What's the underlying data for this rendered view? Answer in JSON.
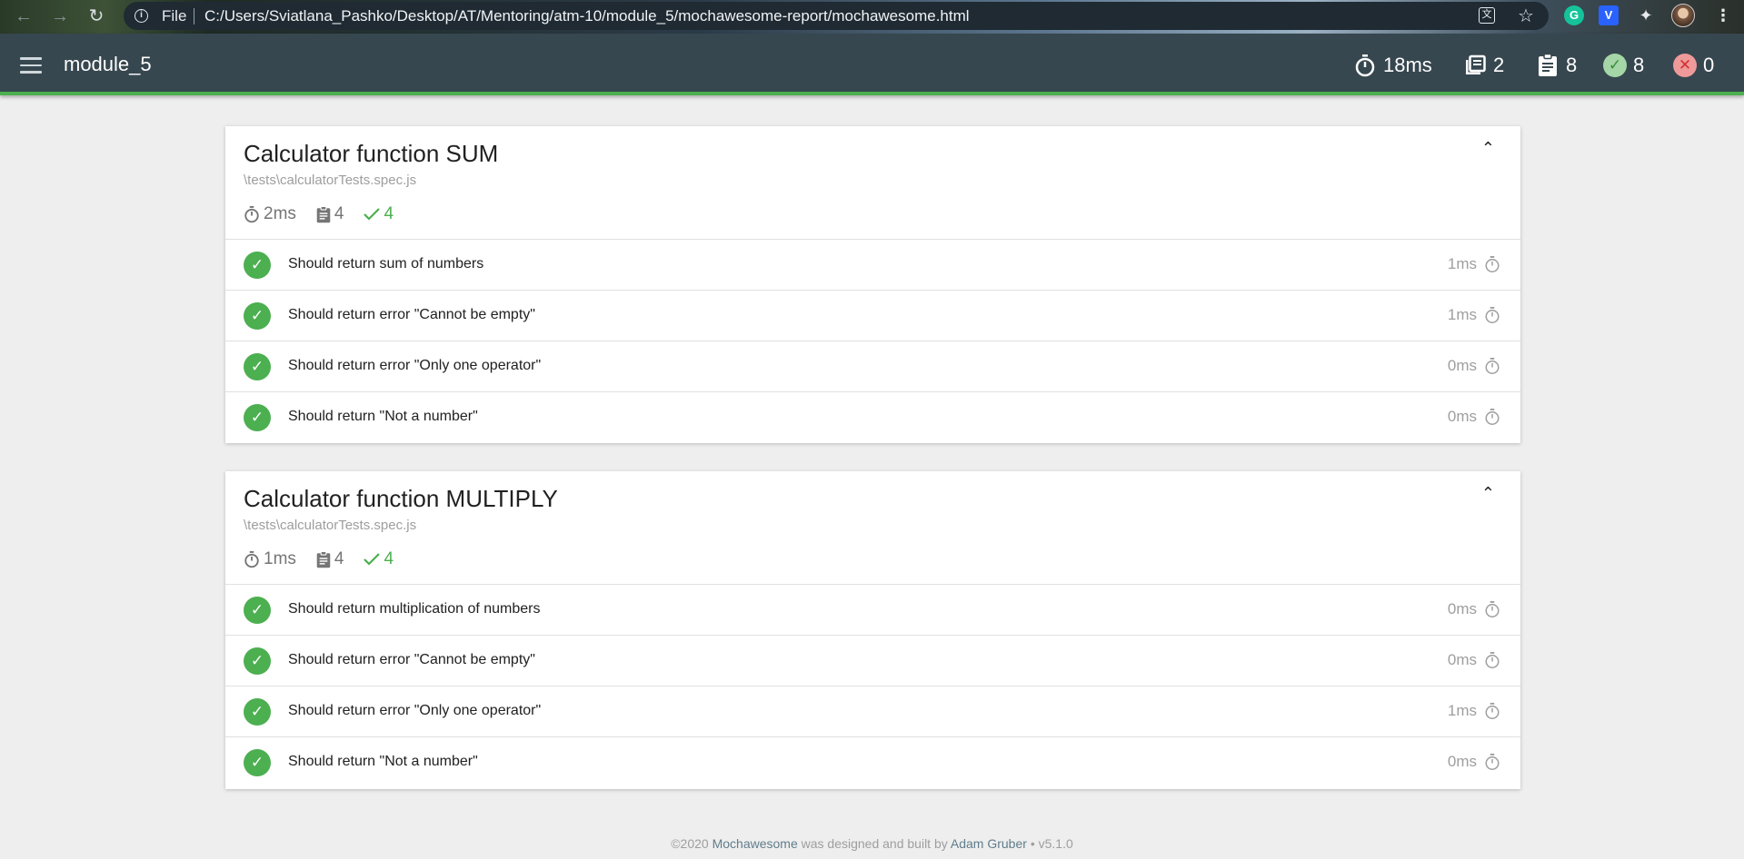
{
  "browser": {
    "protocol_label": "File",
    "url": "C:/Users/Sviatlana_Pashko/Desktop/AT/Mentoring/atm-10/module_5/mochawesome-report/mochawesome.html",
    "extensions": {
      "grammarly": "G",
      "v_ext": "V"
    }
  },
  "navbar": {
    "title": "module_5",
    "duration": "18ms",
    "suites": "2",
    "tests": "8",
    "passes": "8",
    "failures": "0"
  },
  "suites": [
    {
      "title": "Calculator function SUM",
      "file": "\\tests\\calculatorTests.spec.js",
      "duration": "2ms",
      "tests": "4",
      "passes": "4",
      "items": [
        {
          "title": "Should return sum of numbers",
          "duration": "1ms"
        },
        {
          "title": "Should return error \"Cannot be empty\"",
          "duration": "1ms"
        },
        {
          "title": "Should return error \"Only one operator\"",
          "duration": "0ms"
        },
        {
          "title": "Should return \"Not a number\"",
          "duration": "0ms"
        }
      ]
    },
    {
      "title": "Calculator function MULTIPLY",
      "file": "\\tests\\calculatorTests.spec.js",
      "duration": "1ms",
      "tests": "4",
      "passes": "4",
      "items": [
        {
          "title": "Should return multiplication of numbers",
          "duration": "0ms"
        },
        {
          "title": "Should return error \"Cannot be empty\"",
          "duration": "0ms"
        },
        {
          "title": "Should return error \"Only one operator\"",
          "duration": "1ms"
        },
        {
          "title": "Should return \"Not a number\"",
          "duration": "0ms"
        }
      ]
    }
  ],
  "footer": {
    "copyright": "©2020",
    "product": "Mochawesome",
    "middle": "was designed and built by",
    "author": "Adam Gruber",
    "version": "• v5.1.0"
  },
  "colors": {
    "navbar": "#37474f",
    "pass": "#4caf50",
    "fail": "#d32f2f"
  }
}
